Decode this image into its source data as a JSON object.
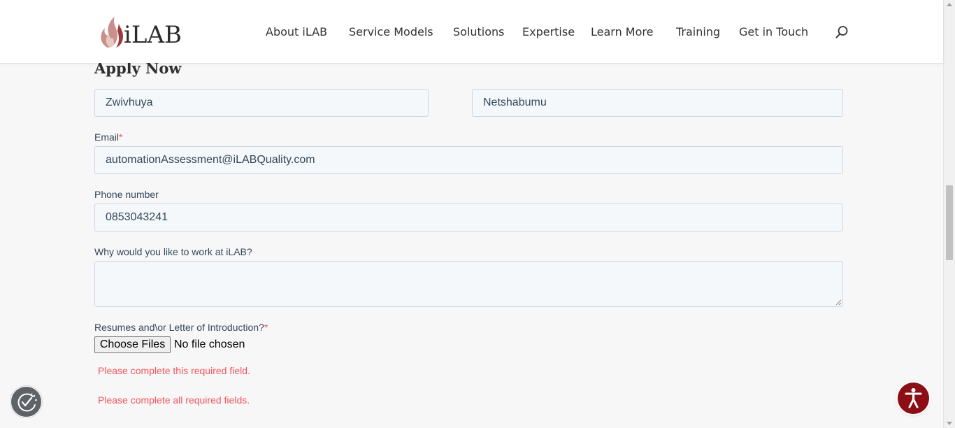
{
  "header": {
    "logo_text": "iLAB",
    "nav": [
      "About iLAB",
      "Service Models",
      "Solutions",
      "Expertise",
      "Learn More",
      "Training",
      "Get in Touch"
    ],
    "search_icon": "search-icon"
  },
  "form": {
    "title": "Apply Now",
    "first_name_value": "Zwivhuya",
    "last_name_value": "Netshabumu",
    "email_label": "Email",
    "email_value": "automationAssessment@iLABQuality.com",
    "phone_label": "Phone number",
    "phone_value": "0853043241",
    "why_label": "Why would you like to work at iLAB?",
    "why_value": "",
    "resume_label": "Resumes and\\or Letter of Introduction?",
    "required_mark": "*",
    "file_button_label": "Choose Files",
    "file_status": "No file chosen",
    "error_field": "Please complete this required field.",
    "error_form": "Please complete all required fields."
  },
  "widgets": {
    "cookie_icon": "cookie-consent-icon",
    "accessibility_icon": "accessibility-icon"
  },
  "colors": {
    "accent_red": "#8b0f14",
    "error_red": "#f2545b",
    "input_bg": "#f5f8fa",
    "input_border": "#cbd6e2"
  }
}
